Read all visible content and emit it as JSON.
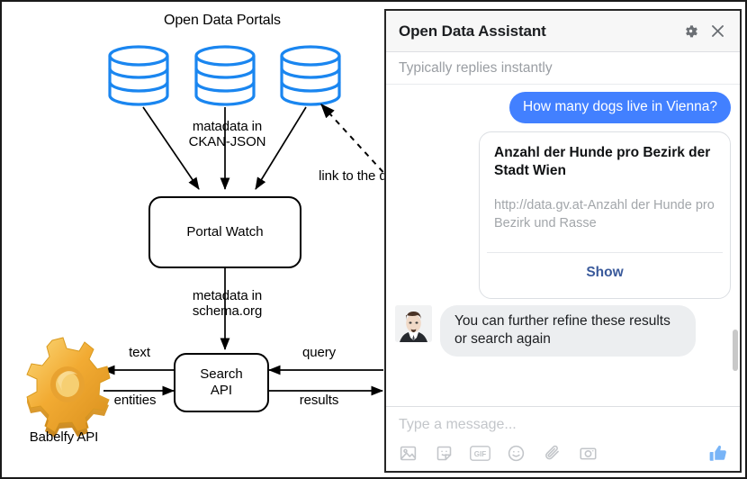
{
  "diagram": {
    "portals_label": "Open Data Portals",
    "edge_ckan": "matadata in\nCKAN-JSON",
    "edge_link": "link to the dataset",
    "edge_schema": "metadata in\nschema.org",
    "edge_text": "text",
    "edge_entities": "entities",
    "edge_query": "query",
    "edge_results": "results",
    "node_portal_watch": "Portal Watch",
    "node_search_api": "Search\nAPI",
    "babelfy_label": "Babelfy API",
    "db_color": "#1a86f0",
    "gear_color": "#f0a828",
    "databases": [
      {
        "name": "database-1"
      },
      {
        "name": "database-2"
      },
      {
        "name": "database-3"
      }
    ]
  },
  "chat": {
    "title": "Open Data Assistant",
    "subtitle": "Typically replies instantly",
    "header_icons": [
      {
        "name": "gear-icon"
      },
      {
        "name": "close-icon"
      }
    ],
    "messages": {
      "user_question": "How many dogs live in Vienna?",
      "assistant_followup": "You can further refine these results or search again"
    },
    "card": {
      "title": "Anzahl der Hunde pro Bezirk der Stadt Wien",
      "subtitle": "http://data.gv.at-Anzahl der Hunde pro Bezirk und Rasse",
      "action": "Show",
      "action_color": "#3a5a9b"
    },
    "composer": {
      "placeholder": "Type a message...",
      "tools": [
        {
          "name": "photo-icon",
          "label": ""
        },
        {
          "name": "sticker-icon",
          "label": ""
        },
        {
          "name": "gif-icon",
          "label": "GIF"
        },
        {
          "name": "emoji-icon",
          "label": ""
        },
        {
          "name": "paperclip-icon",
          "label": ""
        },
        {
          "name": "camera-icon",
          "label": ""
        }
      ],
      "send_like": {
        "name": "thumbs-up-icon"
      }
    },
    "bubble_out_color": "#4280ff",
    "bubble_in_color": "#eceef0"
  }
}
